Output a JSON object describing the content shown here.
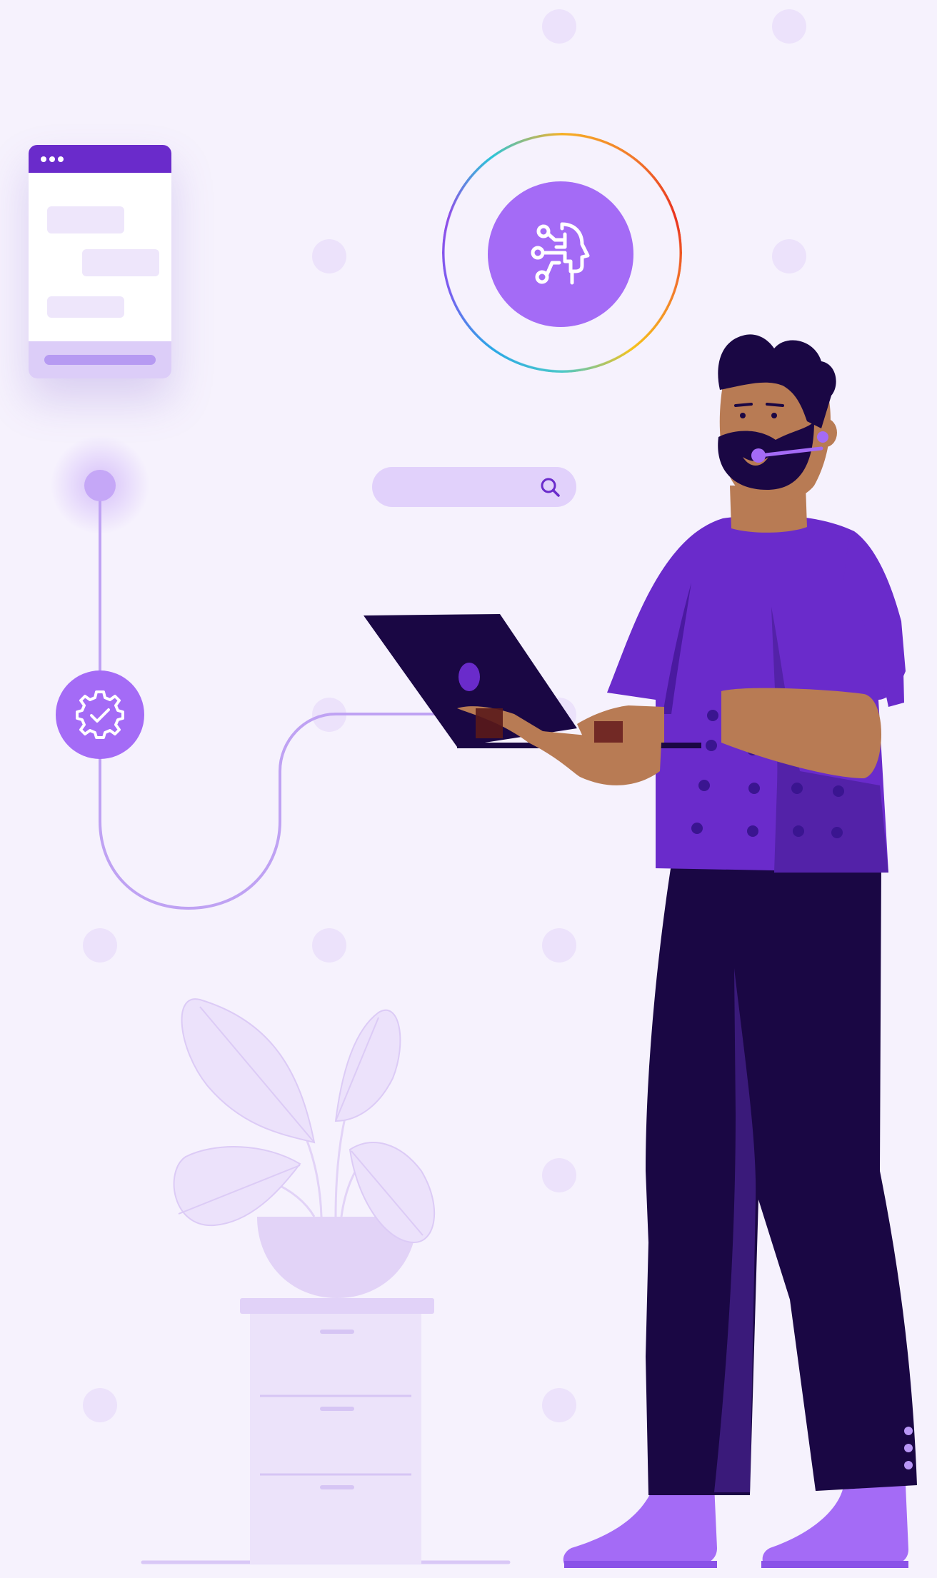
{
  "illustration": {
    "subject": "support-agent-with-headset-using-laptop",
    "chat_window": {
      "titlebar_dots": 3,
      "message_bubbles": 3
    },
    "search_bar": {
      "icon": "search-icon"
    },
    "ai_badge": {
      "icon": "ai-head-circuit-icon"
    },
    "workflow": {
      "node_icon": "gear-check-icon"
    },
    "colors": {
      "background": "#f6f2fd",
      "primary_purple": "#6a2bcb",
      "light_purple": "#a46bf6",
      "dark_purple": "#1a0744",
      "skin": "#b87b54",
      "plant": "#e2d3f7"
    }
  }
}
